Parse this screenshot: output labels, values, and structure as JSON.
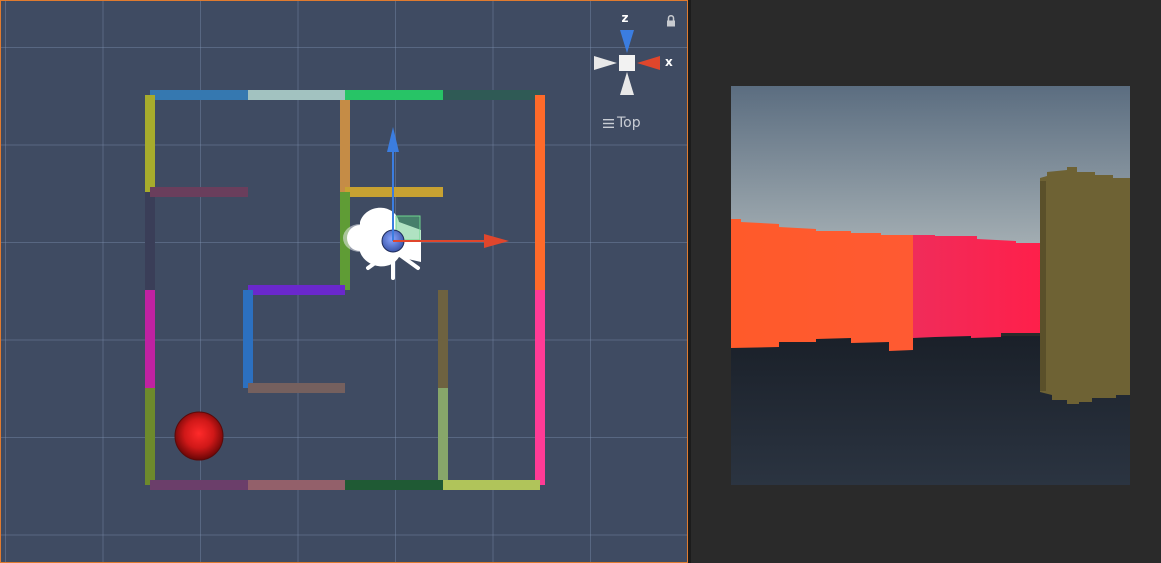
{
  "scene_view": {
    "gizmo": {
      "axis_z": "z",
      "axis_x": "x",
      "view_label": "Top"
    },
    "icons": [
      "lock-icon",
      "menu-icon",
      "camera-icon",
      "sphere-icon",
      "move-tool-icon"
    ],
    "colors": {
      "background": "#3f4b62",
      "grid": "#8296b4",
      "focus_border": "#e07b2f",
      "x_axis": "#e0462c",
      "z_axis": "#3b7de0",
      "red_ball": "#d01818"
    }
  },
  "game_view": {
    "colors": {
      "sky_top": "#5b6d80",
      "sky_bottom": "#a8b2b6",
      "floor": "#1f262f",
      "wall_orange": "#ff5a2e",
      "wall_pink": "#ff1f55",
      "wall_olive": "#6e6234"
    }
  }
}
